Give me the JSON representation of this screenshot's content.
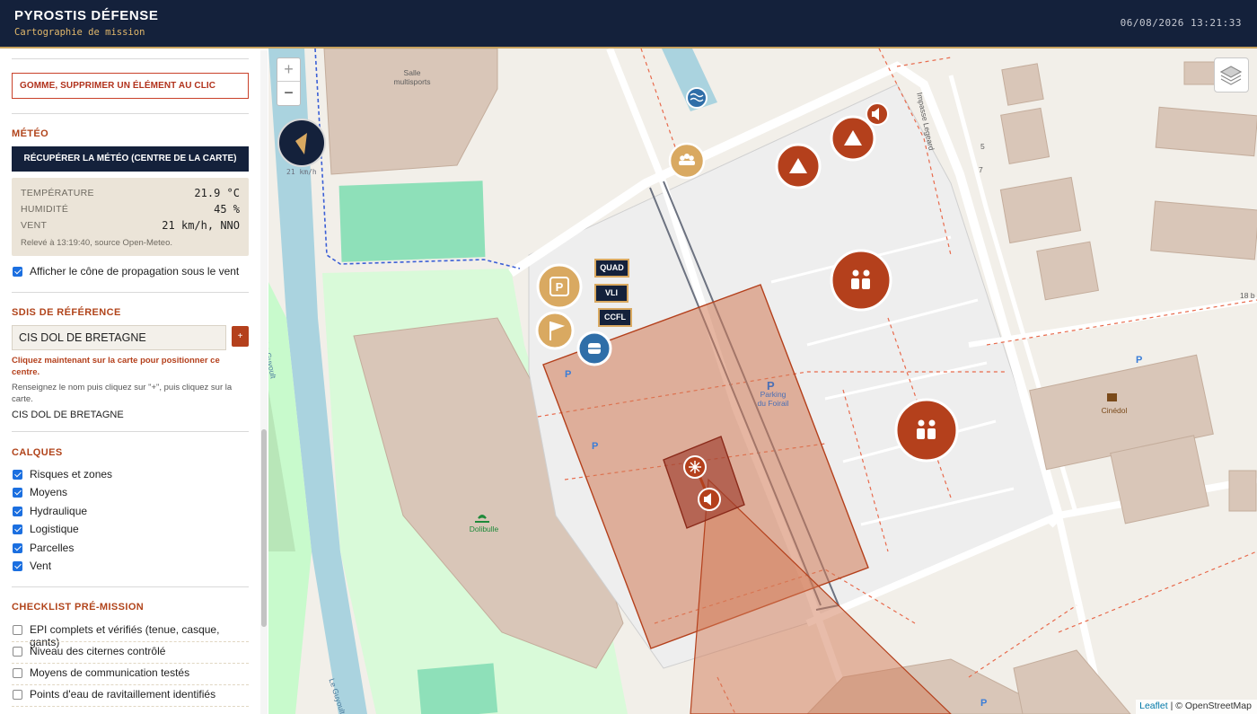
{
  "header": {
    "title": "PYROSTIS DÉFENSE",
    "subtitle": "Cartographie de mission",
    "clock": "06/08/2026 13:21:33"
  },
  "sidebar": {
    "eraser_label": "GOMME, SUPPRIMER UN ÉLÉMENT AU CLIC",
    "meteo": {
      "title": "MÉTÉO",
      "fetch_button": "RÉCUPÉRER LA MÉTÉO (CENTRE DE LA CARTE)",
      "rows": [
        {
          "label": "TEMPÉRATURE",
          "value": "21.9 °C"
        },
        {
          "label": "HUMIDITÉ",
          "value": "45 %"
        },
        {
          "label": "VENT",
          "value": "21 km/h, NNO"
        }
      ],
      "source": "Relevé à 13:19:40, source Open-Meteo.",
      "cone_checkbox": {
        "label": "Afficher le cône de propagation sous le vent",
        "checked": true
      }
    },
    "sdis": {
      "title": "SDIS DE RÉFÉRENCE",
      "input_value": "CIS DOL DE BRETAGNE",
      "add_label": "+",
      "hint": "Cliquez maintenant sur la carte pour positionner ce centre.",
      "help": "Renseignez le nom puis cliquez sur \"+\", puis cliquez sur la carte.",
      "current": "CIS DOL DE BRETAGNE"
    },
    "layers": {
      "title": "CALQUES",
      "items": [
        {
          "label": "Risques et zones",
          "checked": true
        },
        {
          "label": "Moyens",
          "checked": true
        },
        {
          "label": "Hydraulique",
          "checked": true
        },
        {
          "label": "Logistique",
          "checked": true
        },
        {
          "label": "Parcelles",
          "checked": true
        },
        {
          "label": "Vent",
          "checked": true
        }
      ]
    },
    "checklist": {
      "title": "CHECKLIST PRÉ-MISSION",
      "items": [
        {
          "label": "EPI complets et vérifiés (tenue, casque, gants)",
          "checked": false
        },
        {
          "label": "Niveau des citernes contrôlé",
          "checked": false
        },
        {
          "label": "Moyens de communication testés",
          "checked": false
        },
        {
          "label": "Points d'eau de ravitaillement identifiés",
          "checked": false
        }
      ]
    }
  },
  "map": {
    "zoom_in": "+",
    "zoom_out": "−",
    "wind_speed": "21 km/h",
    "labels": {
      "salle": "Salle\nmultisports",
      "impasse": "Impasse Legeard",
      "guyoult1": "Le Guyoult",
      "guyoult2": "Le Guyoult",
      "parking": "Parking\ndu Foirail",
      "dolibulle": "Dolibulle",
      "cinedol": "Cinédol",
      "num5": "5",
      "num7": "7",
      "num18": "18 b"
    },
    "vehicles": [
      "QUAD",
      "VLI",
      "CCFL"
    ],
    "attribution_leaflet": "Leaflet",
    "attribution_osm": "| © OpenStreetMap",
    "colors": {
      "risk": "#b4401c",
      "logistic": "#c9a35f",
      "navy": "#14213b",
      "hydro": "#2f6ea8"
    }
  }
}
